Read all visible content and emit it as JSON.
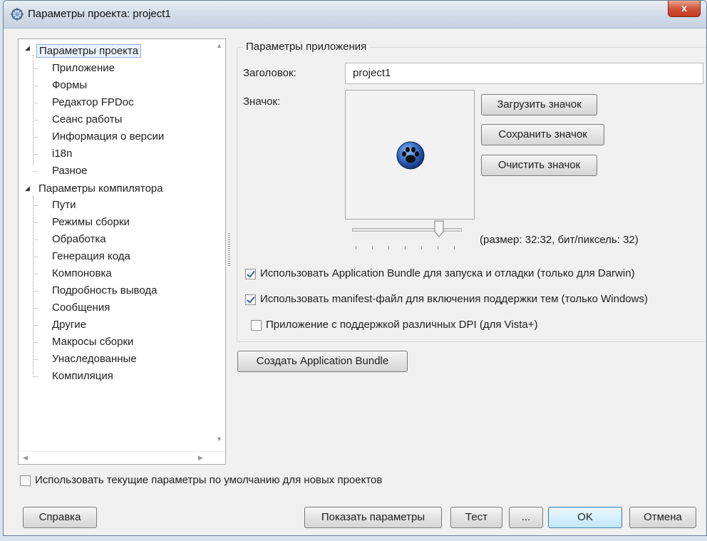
{
  "window": {
    "title": "Параметры проекта: project1",
    "close": "x"
  },
  "tree": {
    "items": [
      {
        "label": "Параметры проекта",
        "level": 0,
        "expanded": true,
        "selected": true
      },
      {
        "label": "Приложение",
        "level": 1
      },
      {
        "label": "Формы",
        "level": 1
      },
      {
        "label": "Редактор FPDoc",
        "level": 1
      },
      {
        "label": "Сеанс работы",
        "level": 1
      },
      {
        "label": "Информация о версии",
        "level": 1
      },
      {
        "label": "i18n",
        "level": 1
      },
      {
        "label": "Разное",
        "level": 1
      },
      {
        "label": "Параметры компилятора",
        "level": 0,
        "expanded": true
      },
      {
        "label": "Пути",
        "level": 1
      },
      {
        "label": "Режимы сборки",
        "level": 1
      },
      {
        "label": "Обработка",
        "level": 1
      },
      {
        "label": "Генерация кода",
        "level": 1
      },
      {
        "label": "Компоновка",
        "level": 1
      },
      {
        "label": "Подробность вывода",
        "level": 1
      },
      {
        "label": "Сообщения",
        "level": 1
      },
      {
        "label": "Другие",
        "level": 1
      },
      {
        "label": "Макросы сборки",
        "level": 1
      },
      {
        "label": "Унаследованные",
        "level": 1
      },
      {
        "label": "Компиляция",
        "level": 1
      }
    ]
  },
  "app_settings": {
    "group_title": "Параметры приложения",
    "title_label": "Заголовок:",
    "title_value": "project1",
    "icon_label": "Значок:",
    "load_icon": "Загрузить значок",
    "save_icon": "Сохранить значок",
    "clear_icon": "Очистить значок",
    "size_info": "(размер: 32:32, бит/пиксель: 32)",
    "use_app_bundle": {
      "label": "Использовать Application Bundle для запуска и отладки (только для Darwin)",
      "checked": true
    },
    "use_manifest": {
      "label": "Использовать manifest-файл для включения поддержки тем (только Windows)",
      "checked": true
    },
    "dpi_aware": {
      "label": "Приложение с поддержкой различных DPI (для Vista+)",
      "checked": false
    },
    "create_bundle": "Создать Application Bundle"
  },
  "footer": {
    "use_defaults": {
      "label": "Использовать текущие параметры по умолчанию для новых проектов",
      "checked": false
    },
    "help": "Справка",
    "show_options": "Показать параметры",
    "test": "Тест",
    "more": "...",
    "ok": "OK",
    "cancel": "Отмена"
  },
  "colors": {
    "accent": "#3c7fb1",
    "close": "#c03b22",
    "paw": "#2b5fb8"
  }
}
